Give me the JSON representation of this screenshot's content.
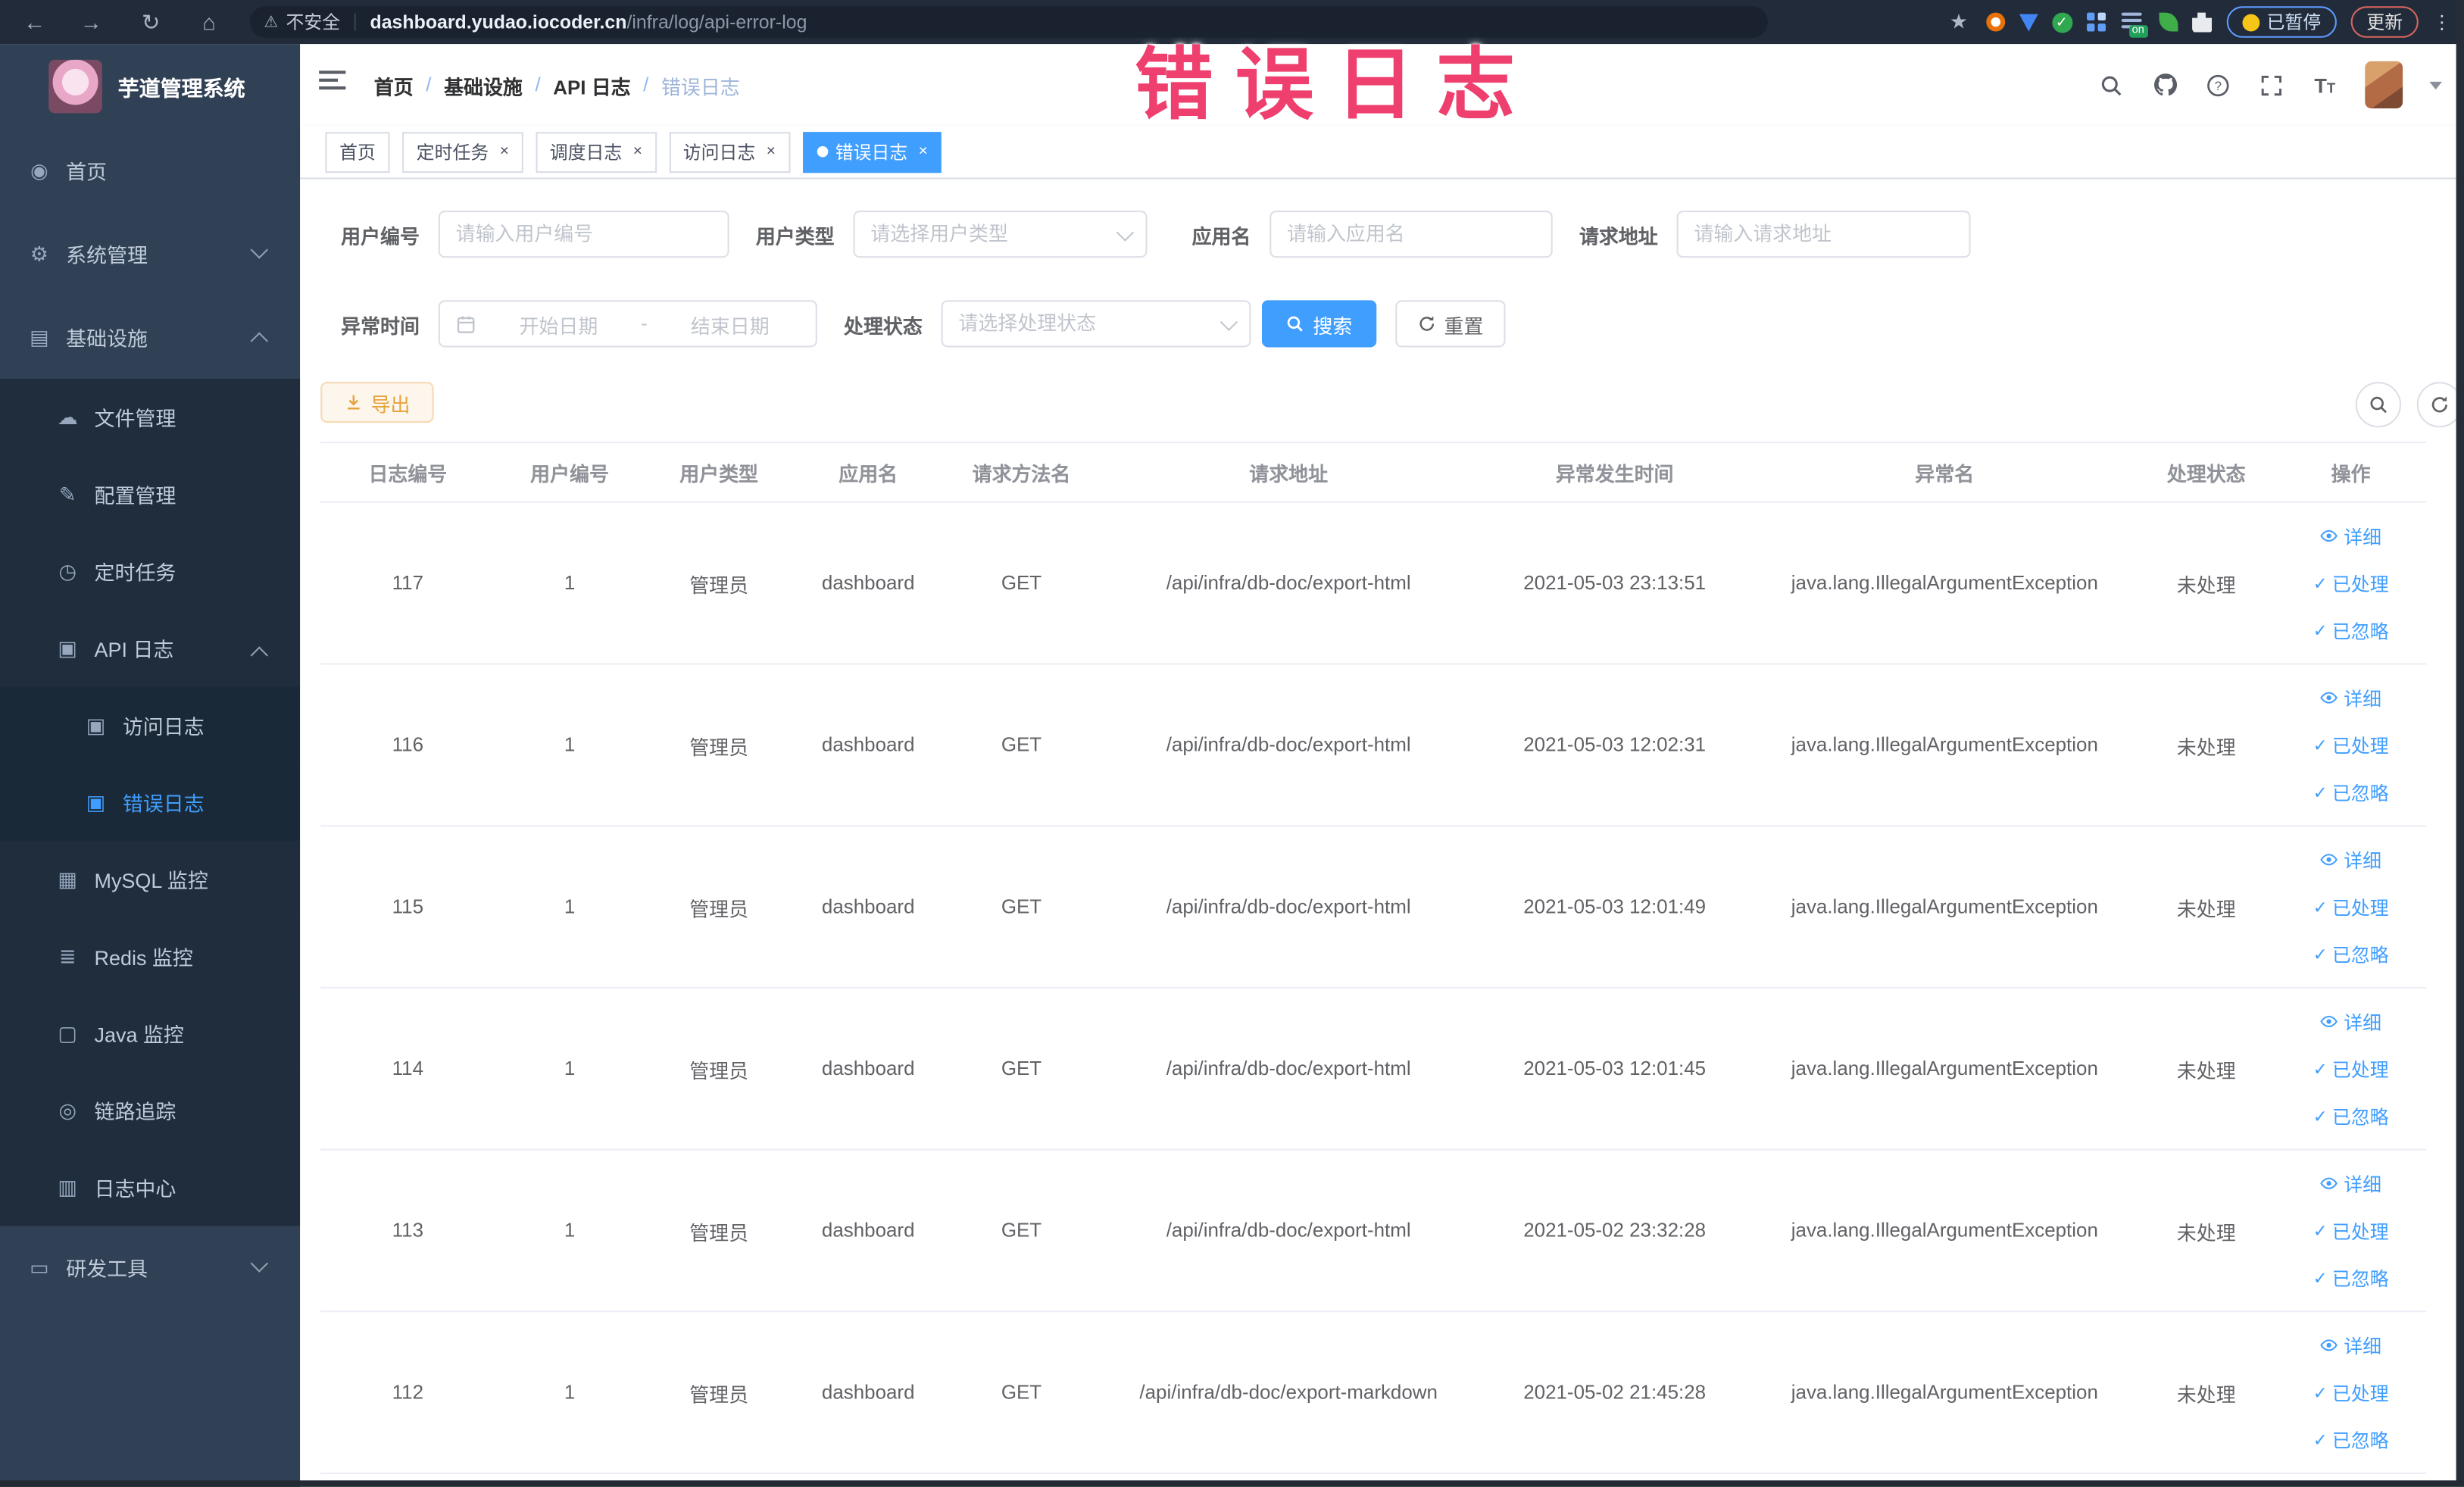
{
  "browser": {
    "security_label": "不安全",
    "url_domain": "dashboard.yudao.iocoder.cn",
    "url_path": "/infra/log/api-error-log",
    "extension_badge": "on",
    "paused_label": "已暂停",
    "update_label": "更新"
  },
  "overlay": {
    "watermark_text": "错误日志",
    "watermark_color": "#ee3f6e"
  },
  "sidebar": {
    "title": "芋道管理系统",
    "menu": [
      {
        "id": "home",
        "label": "首页",
        "level": 1,
        "icon": "dashboard",
        "glyph": "◉"
      },
      {
        "id": "system",
        "label": "系统管理",
        "level": 1,
        "icon": "gear",
        "glyph": "⚙",
        "arrow": "down"
      },
      {
        "id": "infra",
        "label": "基础设施",
        "level": 1,
        "icon": "monitor",
        "glyph": "▤",
        "arrow": "up"
      },
      {
        "id": "file-manage",
        "label": "文件管理",
        "level": 2,
        "icon": "cloud",
        "glyph": "☁",
        "section": "sub"
      },
      {
        "id": "config-manage",
        "label": "配置管理",
        "level": 2,
        "icon": "edit",
        "glyph": "✎",
        "section": "sub"
      },
      {
        "id": "scheduled-job",
        "label": "定时任务",
        "level": 2,
        "icon": "clock",
        "glyph": "◷",
        "section": "sub"
      },
      {
        "id": "api-log",
        "label": "API 日志",
        "level": 2,
        "icon": "log",
        "glyph": "▣",
        "arrow": "up",
        "section": "sub"
      },
      {
        "id": "access-log",
        "label": "访问日志",
        "level": 3,
        "icon": "log",
        "glyph": "▣",
        "section": "sub"
      },
      {
        "id": "error-log",
        "label": "错误日志",
        "level": 3,
        "icon": "log",
        "glyph": "▣",
        "active": true,
        "section": "sub"
      },
      {
        "id": "mysql-monitor",
        "label": "MySQL 监控",
        "level": 2,
        "icon": "mysql",
        "glyph": "▦",
        "section": "sub"
      },
      {
        "id": "redis-monitor",
        "label": "Redis 监控",
        "level": 2,
        "icon": "redis",
        "glyph": "≣",
        "section": "sub"
      },
      {
        "id": "java-monitor",
        "label": "Java 监控",
        "level": 2,
        "icon": "java",
        "glyph": "▢",
        "section": "sub"
      },
      {
        "id": "trace",
        "label": "链路追踪",
        "level": 2,
        "icon": "eye",
        "glyph": "◎",
        "section": "sub"
      },
      {
        "id": "log-center",
        "label": "日志中心",
        "level": 2,
        "icon": "log",
        "glyph": "▥",
        "section": "sub"
      },
      {
        "id": "dev-tools",
        "label": "研发工具",
        "level": 1,
        "icon": "toolbox",
        "glyph": "▭",
        "arrow": "down"
      }
    ]
  },
  "topbar": {
    "breadcrumb": [
      "首页",
      "基础设施",
      "API 日志",
      "错误日志"
    ]
  },
  "tabs": [
    {
      "label": "首页",
      "closable": false,
      "active": false
    },
    {
      "label": "定时任务",
      "closable": true,
      "active": false
    },
    {
      "label": "调度日志",
      "closable": true,
      "active": false
    },
    {
      "label": "访问日志",
      "closable": true,
      "active": false
    },
    {
      "label": "错误日志",
      "closable": true,
      "active": true
    }
  ],
  "filters": {
    "user_id": {
      "label": "用户编号",
      "placeholder": "请输入用户编号"
    },
    "user_type": {
      "label": "用户类型",
      "placeholder": "请选择用户类型"
    },
    "app_name": {
      "label": "应用名",
      "placeholder": "请输入应用名"
    },
    "request_url": {
      "label": "请求地址",
      "placeholder": "请输入请求地址"
    },
    "exception_time": {
      "label": "异常时间",
      "start_placeholder": "开始日期",
      "separator": "-",
      "end_placeholder": "结束日期"
    },
    "process_status": {
      "label": "处理状态",
      "placeholder": "请选择处理状态"
    },
    "search_label": "搜索",
    "reset_label": "重置"
  },
  "toolbar": {
    "export_label": "导出"
  },
  "table": {
    "columns": [
      "日志编号",
      "用户编号",
      "用户类型",
      "应用名",
      "请求方法名",
      "请求地址",
      "异常发生时间",
      "异常名",
      "处理状态",
      "操作"
    ],
    "action_labels": {
      "detail": "详细",
      "processed": "已处理",
      "ignored": "已忽略"
    },
    "rows": [
      {
        "id": "117",
        "user_id": "1",
        "user_type": "管理员",
        "app": "dashboard",
        "method": "GET",
        "url": "/api/infra/db-doc/export-html",
        "time": "2021-05-03 23:13:51",
        "exception": "java.lang.IllegalArgumentException",
        "status": "未处理"
      },
      {
        "id": "116",
        "user_id": "1",
        "user_type": "管理员",
        "app": "dashboard",
        "method": "GET",
        "url": "/api/infra/db-doc/export-html",
        "time": "2021-05-03 12:02:31",
        "exception": "java.lang.IllegalArgumentException",
        "status": "未处理"
      },
      {
        "id": "115",
        "user_id": "1",
        "user_type": "管理员",
        "app": "dashboard",
        "method": "GET",
        "url": "/api/infra/db-doc/export-html",
        "time": "2021-05-03 12:01:49",
        "exception": "java.lang.IllegalArgumentException",
        "status": "未处理"
      },
      {
        "id": "114",
        "user_id": "1",
        "user_type": "管理员",
        "app": "dashboard",
        "method": "GET",
        "url": "/api/infra/db-doc/export-html",
        "time": "2021-05-03 12:01:45",
        "exception": "java.lang.IllegalArgumentException",
        "status": "未处理"
      },
      {
        "id": "113",
        "user_id": "1",
        "user_type": "管理员",
        "app": "dashboard",
        "method": "GET",
        "url": "/api/infra/db-doc/export-html",
        "time": "2021-05-02 23:32:28",
        "exception": "java.lang.IllegalArgumentException",
        "status": "未处理"
      },
      {
        "id": "112",
        "user_id": "1",
        "user_type": "管理员",
        "app": "dashboard",
        "method": "GET",
        "url": "/api/infra/db-doc/export-markdown",
        "time": "2021-05-02 21:45:28",
        "exception": "java.lang.IllegalArgumentException",
        "status": "未处理"
      }
    ]
  }
}
